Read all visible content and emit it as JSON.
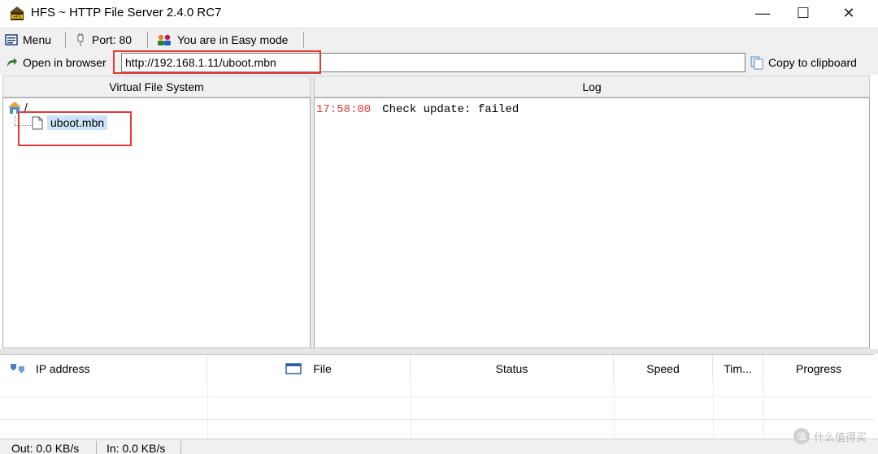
{
  "window": {
    "title": "HFS ~ HTTP File Server 2.4.0 RC7",
    "controls": {
      "minimize": "—",
      "maximize": "☐",
      "close": "✕"
    }
  },
  "toolbar": {
    "menu_label": "Menu",
    "port_label": "Port: 80",
    "mode_label": "You are in Easy mode"
  },
  "urlbar": {
    "open_label": "Open in browser",
    "url_value": "http://192.168.1.11/uboot.mbn",
    "copy_label": "Copy to clipboard"
  },
  "vfs": {
    "header": "Virtual File System",
    "root_label": "/",
    "items": [
      {
        "label": "uboot.mbn"
      }
    ]
  },
  "log": {
    "header": "Log",
    "entries": [
      {
        "time": "17:58:00",
        "message": "Check update: failed"
      }
    ]
  },
  "connections": {
    "columns": [
      "IP address",
      "File",
      "Status",
      "Speed",
      "Tim...",
      "Progress"
    ]
  },
  "statusbar": {
    "out_label": "Out: 0.0 KB/s",
    "in_label": "In: 0.0 KB/s"
  },
  "watermark": {
    "text": "什么值得买"
  },
  "colors": {
    "accent_red": "#e53935",
    "log_time": "#e53935",
    "chrome": "#f0f0f0"
  }
}
